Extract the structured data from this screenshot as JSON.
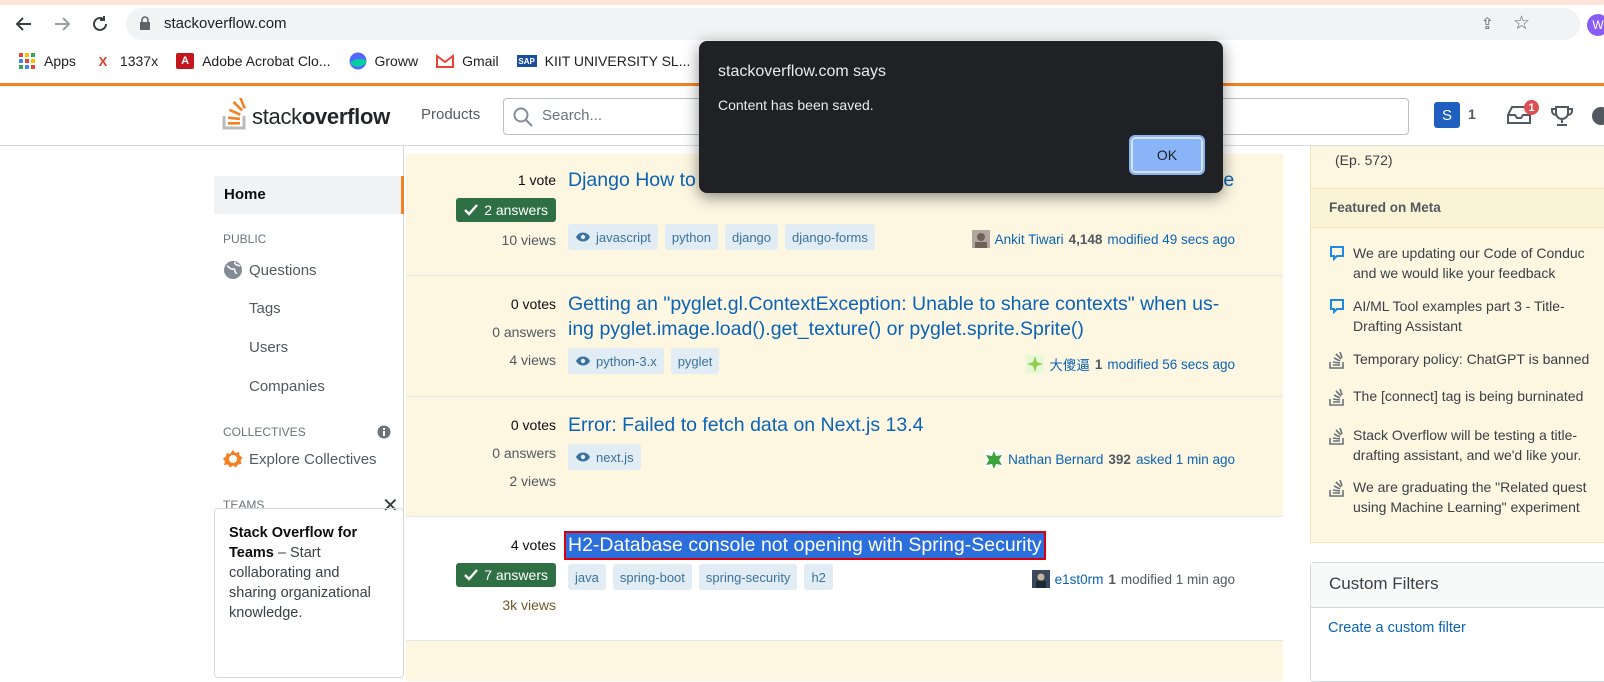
{
  "browser": {
    "url": "stackoverflow.com",
    "profile_initial": "W",
    "bookmarks": [
      {
        "label": "Apps",
        "icon": "apps-grid-icon"
      },
      {
        "label": "1337x",
        "icon": "1337x-icon"
      },
      {
        "label": "Adobe Acrobat Clo...",
        "icon": "adobe-acrobat-icon"
      },
      {
        "label": "Groww",
        "icon": "groww-icon"
      },
      {
        "label": "Gmail",
        "icon": "gmail-icon"
      },
      {
        "label": "KIIT UNIVERSITY SL...",
        "icon": "sap-icon"
      }
    ]
  },
  "so": {
    "logo_plain": "stack",
    "logo_bold": "overflow",
    "products": "Products",
    "search_placeholder": "Search...",
    "avatar_letter": "S",
    "reputation": "1",
    "inbox_count": "1"
  },
  "leftnav": {
    "home": "Home",
    "public_label": "PUBLIC",
    "questions": "Questions",
    "tags": "Tags",
    "users": "Users",
    "companies": "Companies",
    "collectives_label": "COLLECTIVES",
    "explore_collectives": "Explore Collectives",
    "teams_label": "TEAMS",
    "teams_title": "Stack Overflow for Teams",
    "teams_desc": " – Start collaborating and sharing organizational knowledge."
  },
  "questions": [
    {
      "votes": "1 vote",
      "answers": "2 answers",
      "views": "10 views",
      "title": "Django How to get value of CheckboxSelectMultiple in Javascript in Template",
      "tags": [
        "javascript",
        "python",
        "django",
        "django-forms"
      ],
      "owner": "Ankit Tiwari",
      "rep": "4,148",
      "activity": "modified 49 secs ago"
    },
    {
      "votes": "0 votes",
      "answers": "0 answers",
      "views": "4 views",
      "title": "Getting an \"pyglet.gl.ContextException: Unable to share contexts\" when us-ing pyglet.image.load().get_texture() or pyglet.sprite.Sprite()",
      "tags": [
        "python-3.x",
        "pyglet"
      ],
      "owner": "大傻逼",
      "rep": "1",
      "activity": "modified 56 secs ago"
    },
    {
      "votes": "0 votes",
      "answers": "0 answers",
      "views": "2 views",
      "title": "Error: Failed to fetch data on Next.js 13.4",
      "tags": [
        "next.js"
      ],
      "owner": "Nathan Bernard",
      "rep": "392",
      "activity": "asked 1 min ago"
    },
    {
      "votes": "4 votes",
      "answers": "7 answers",
      "views": "3k views",
      "title": "H2-Database console not opening with Spring-Security",
      "tags": [
        "java",
        "spring-boot",
        "spring-security",
        "h2"
      ],
      "owner": "e1st0rm",
      "rep": "1",
      "activity": "modified 1 min ago"
    }
  ],
  "rightside": {
    "episode": "(Ep. 572)",
    "featured_meta": "Featured on Meta",
    "meta_items": [
      {
        "line1": "We are updating our Code of Conduc",
        "line2": "and we would like your feedback",
        "icon": "speech-bubble-icon"
      },
      {
        "line1": "AI/ML Tool examples part 3 - Title-",
        "line2": "Drafting Assistant",
        "icon": "speech-bubble-icon"
      },
      {
        "line1": "Temporary policy: ChatGPT is banned",
        "line2": "",
        "icon": "stackoverflow-icon"
      },
      {
        "line1": "The [connect] tag is being burninated",
        "line2": "",
        "icon": "stackoverflow-icon"
      },
      {
        "line1": "Stack Overflow will be testing a title-",
        "line2": "drafting assistant, and we'd like your.",
        "icon": "stackoverflow-icon"
      },
      {
        "line1": "We are graduating the \"Related quest",
        "line2": "using Machine Learning\" experiment",
        "icon": "stackoverflow-icon"
      }
    ],
    "custom_filters": "Custom Filters",
    "create_filter": "Create a custom filter"
  },
  "dialog": {
    "title": "stackoverflow.com says",
    "message": "Content has been saved.",
    "ok": "OK"
  }
}
